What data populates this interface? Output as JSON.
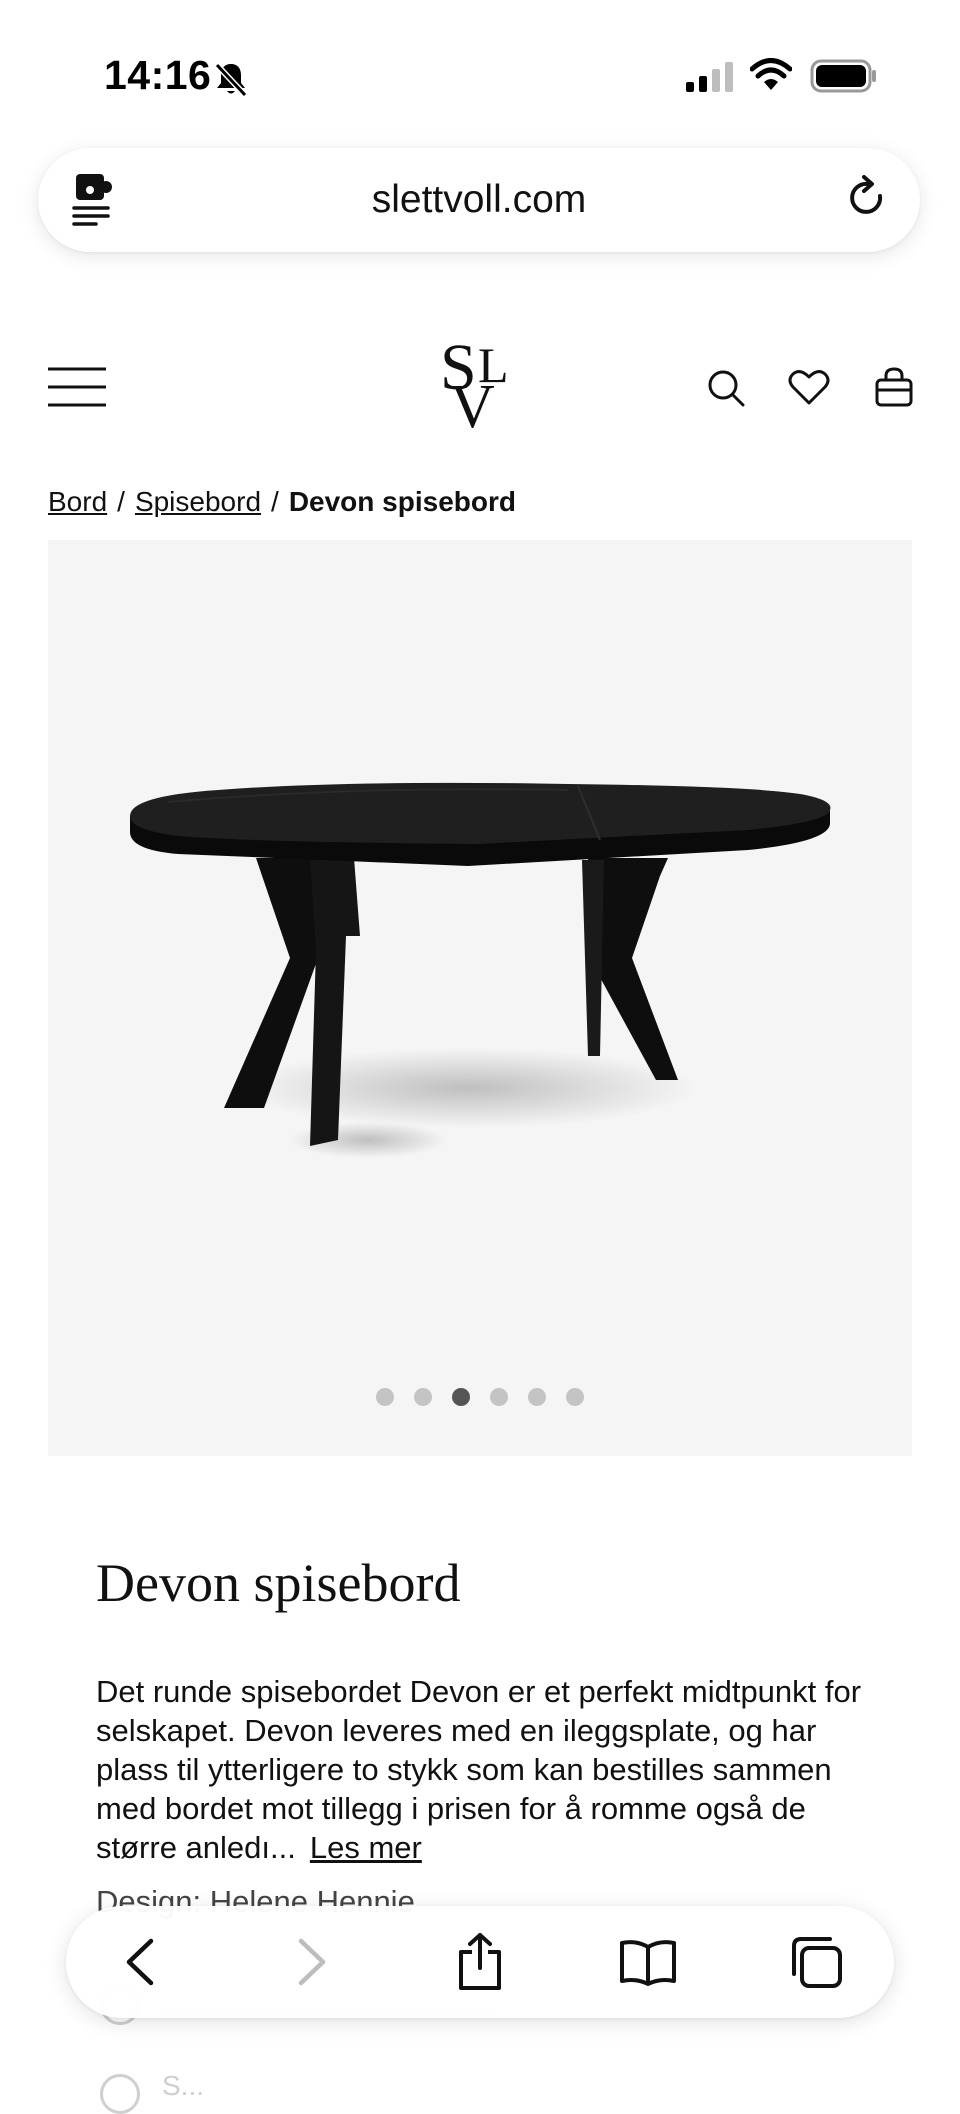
{
  "status_bar": {
    "time": "14:16"
  },
  "browser": {
    "url": "slettvoll.com"
  },
  "site": {
    "logo": {
      "s": "S",
      "l": "L",
      "v": "V"
    }
  },
  "breadcrumb": {
    "items": [
      "Bord",
      "Spisebord"
    ],
    "separator": "/",
    "current": "Devon spisebord"
  },
  "gallery": {
    "image_count": 6,
    "active_index": 2
  },
  "product": {
    "title": "Devon spisebord",
    "description": "Det runde spisebordet Devon er et perfekt midtpunkt for selskapet. Devon leveres med en ileggsplate, og har plass til ytterligere to stykk som kan bestilles sammen med bordet mot tillegg i prisen for å romme også de større anledı...",
    "read_more": "Les mer",
    "design": "Design: Helene Hennie"
  },
  "options": {
    "second_label": "S..."
  },
  "icons": {
    "status": [
      "bell-slash-icon",
      "signal-icon",
      "wifi-icon",
      "battery-icon"
    ],
    "header": [
      "menu-icon",
      "search-icon",
      "heart-icon",
      "bag-icon"
    ],
    "toolbar": [
      "back-icon",
      "forward-icon",
      "share-icon",
      "bookmarks-icon",
      "tabs-icon"
    ]
  }
}
